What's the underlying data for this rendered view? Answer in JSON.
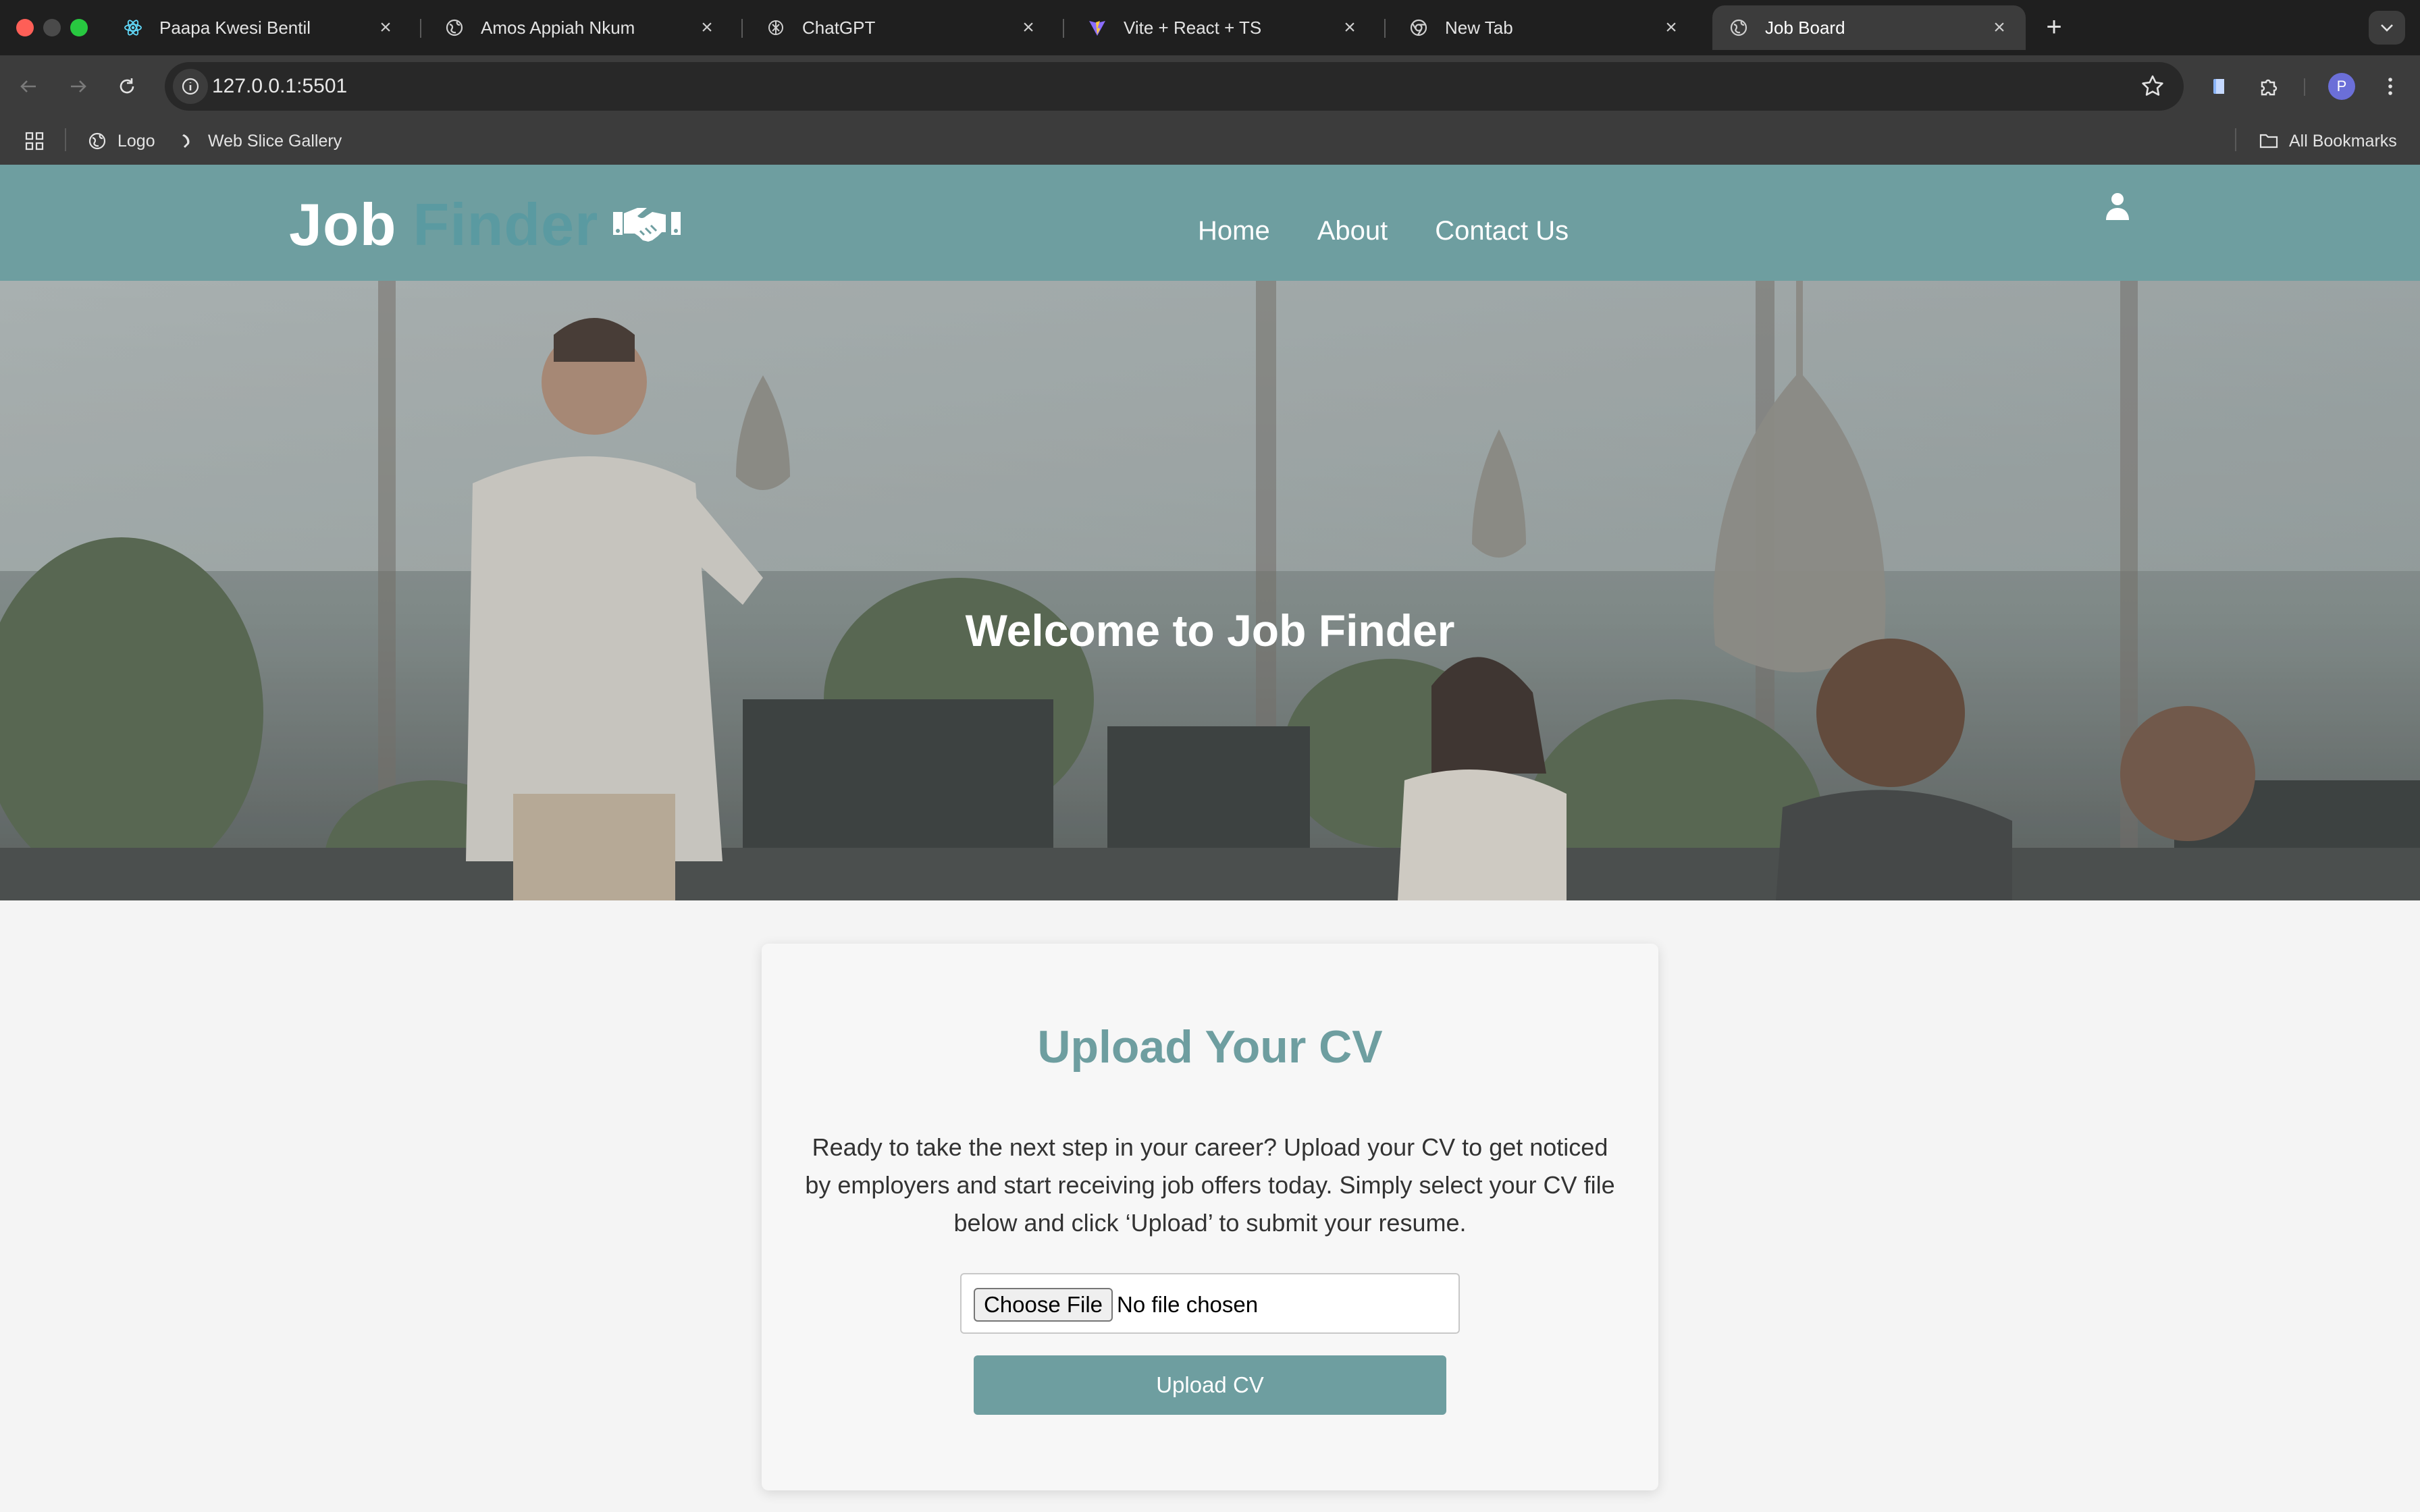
{
  "browser": {
    "tabs": [
      {
        "title": "Paapa Kwesi Bentil",
        "icon": "react-icon"
      },
      {
        "title": "Amos Appiah Nkum",
        "icon": "globe-icon"
      },
      {
        "title": "ChatGPT",
        "icon": "chatgpt-icon"
      },
      {
        "title": "Vite + React + TS",
        "icon": "vite-icon"
      },
      {
        "title": "New Tab",
        "icon": "chrome-icon"
      },
      {
        "title": "Job Board",
        "icon": "globe-icon",
        "active": true
      }
    ],
    "url": "127.0.0.1:5501",
    "profile_initial": "P",
    "bookmarks": [
      {
        "label": "Logo",
        "icon": "globe-icon"
      },
      {
        "label": "Web Slice Gallery",
        "icon": "slice-icon"
      }
    ],
    "all_bookmarks_label": "All Bookmarks"
  },
  "site": {
    "logo": {
      "word1": "Job",
      "word2": "Finder",
      "icon": "handshake-icon"
    },
    "nav": [
      "Home",
      "About",
      "Contact Us"
    ],
    "user_icon": "user-icon",
    "colors": {
      "header": "#6e9ea0",
      "accent": "#5a9aa1",
      "button": "#6e9ea0"
    }
  },
  "hero": {
    "title": "Welcome to Job Finder"
  },
  "upload": {
    "title": "Upload Your CV",
    "description": "Ready to take the next step in your career? Upload your CV to get noticed by employers and start receiving job offers today. Simply select your CV file below and click ‘Upload’ to submit your resume.",
    "choose_label": "Choose File",
    "file_status": "No file chosen",
    "submit_label": "Upload CV"
  }
}
